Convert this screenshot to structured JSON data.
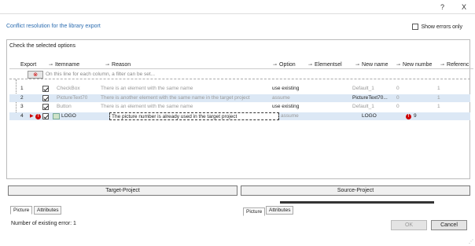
{
  "window": {
    "help_label": "?",
    "close_label": "X"
  },
  "dialog": {
    "title": "Conflict resolution for the library export",
    "show_errors_label": "Show errors only",
    "section_label": "Check the selected options",
    "filter_hint": "On this line for each column, a filter can be set...",
    "columns": {
      "export": "Export",
      "itemname": "Itemname",
      "reason": "Reason",
      "option": "Option",
      "elementsel": "Elementsel",
      "newname": "New name",
      "newnumber": "New numbe",
      "reference": "Referenc"
    },
    "rows": [
      {
        "num": "1",
        "itemname": "CheckBox",
        "reason": "There is an element with the same name",
        "option": "use existing",
        "newname": "Default_1",
        "newnumber": "0",
        "reference": "1"
      },
      {
        "num": "2",
        "itemname": "PictureText70",
        "reason": "There is another element with the same name in the target project",
        "option": "assume",
        "newname": "PictureText70...",
        "newnumber": "0",
        "reference": "1"
      },
      {
        "num": "3",
        "itemname": "Button",
        "reason": "There is an element with the same name",
        "option": "use existing",
        "newname": "Default_1",
        "newnumber": "0",
        "reference": "1"
      },
      {
        "num": "4",
        "itemname": "LOGO",
        "reason": "The picture number is already used in the target project",
        "option": "assume",
        "newname": "LOGO",
        "newnumber": "9",
        "reference": ""
      }
    ]
  },
  "bottom": {
    "target_label": "Target-Project",
    "source_label": "Source-Project",
    "tab_picture": "Picture",
    "tab_attributes": "Attributes",
    "error_count": "Number of existing error: 1",
    "ok_label": "OK",
    "cancel_label": "Cancel"
  },
  "colors": {
    "title_blue": "#2b6cb0",
    "selected_row": "#dce8f5",
    "error_red": "#cc0000"
  }
}
